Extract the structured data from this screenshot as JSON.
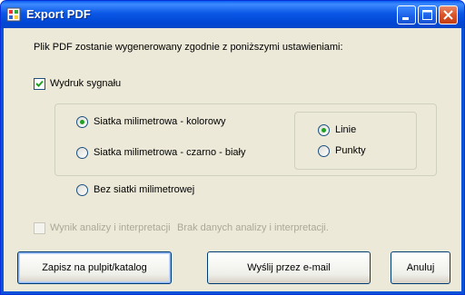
{
  "window": {
    "title": "Export PDF"
  },
  "intro_text": "Plik PDF zostanie wygenerowany zgodnie z poniższymi ustawieniami:",
  "print_signal": {
    "label": "Wydruk sygnału",
    "checked": true
  },
  "grid_options": [
    {
      "label": "Siatka milimetrowa - kolorowy",
      "selected": true
    },
    {
      "label": "Siatka milimetrowa - czarno - biały",
      "selected": false
    },
    {
      "label": "Bez siatki milimetrowej",
      "selected": false
    }
  ],
  "style_options": [
    {
      "label": "Linie",
      "selected": true
    },
    {
      "label": "Punkty",
      "selected": false
    }
  ],
  "analysis": {
    "label": "Wynik analizy i interpretacji",
    "note": "Brak danych analizy i interpretacji.",
    "enabled": false
  },
  "buttons": {
    "save": "Zapisz na pulpit/katalog",
    "email": "Wyślij przez e-mail",
    "cancel": "Anuluj"
  },
  "colors": {
    "titlebar": "#0a53d8",
    "client": "#ece9d8",
    "radio_dot": "#21a121",
    "disabled_text": "#aca899"
  },
  "icons": [
    "app-icon",
    "minimize-icon",
    "maximize-icon",
    "close-icon",
    "checkmark-icon"
  ]
}
